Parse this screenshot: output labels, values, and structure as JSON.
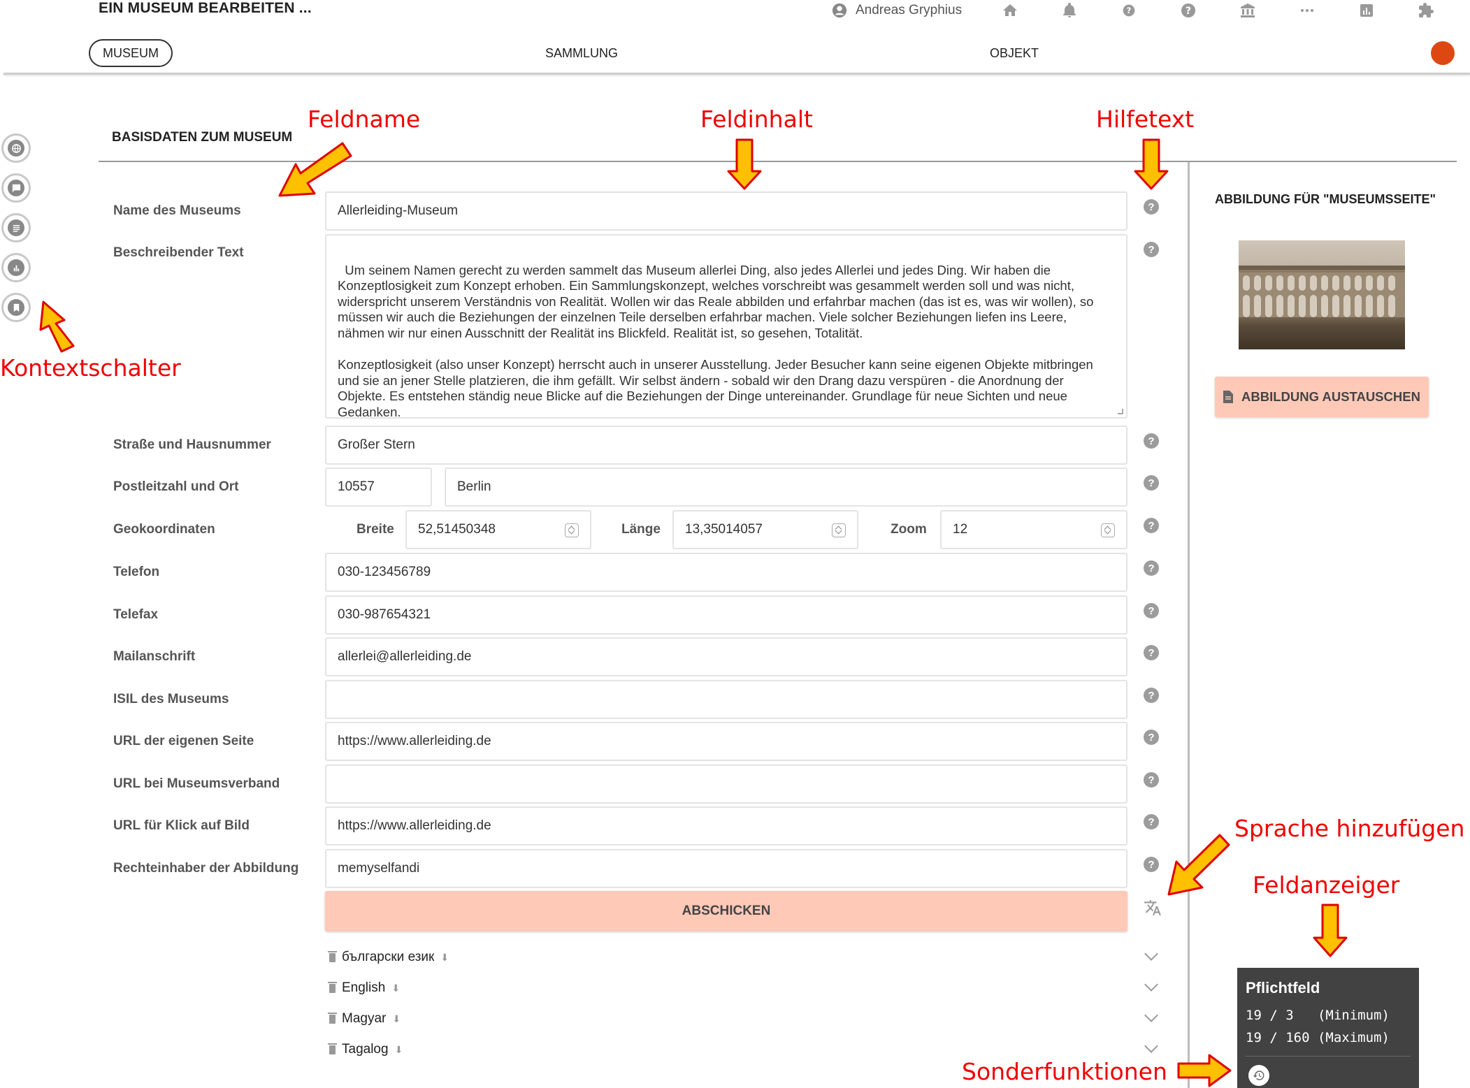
{
  "header": {
    "title": "EIN MUSEUM BEARBEITEN ...",
    "user_name": "Andreas Gryphius",
    "icons": [
      "account-icon",
      "home-icon",
      "bell-icon",
      "help-circle-icon",
      "help-icon",
      "museum-icon",
      "more-icon",
      "chart-icon",
      "puzzle-icon"
    ],
    "status_color": "#dd4812"
  },
  "nav": {
    "tabs": [
      {
        "label": "MUSEUM",
        "active": true
      },
      {
        "label": "SAMMLUNG",
        "active": false
      },
      {
        "label": "OBJEKT",
        "active": false
      }
    ]
  },
  "context_switcher": {
    "icons": [
      "globe-icon",
      "chat-icon",
      "list-icon",
      "chart-icon",
      "bookmark-icon"
    ]
  },
  "section": {
    "title": "BASISDATEN ZUM MUSEUM"
  },
  "form": {
    "name": {
      "label": "Name des Museums",
      "value": "Allerleiding-Museum"
    },
    "description": {
      "label": "Beschreibender Text",
      "value": "Um seinem Namen gerecht zu werden sammelt das Museum allerlei Ding, also jedes Allerlei und jedes Ding. Wir haben die\nKonzeptlosigkeit zum Konzept erhoben. Ein Sammlungskonzept, welches vorschreibt was gesammelt werden soll und was nicht,\nwiderspricht unserem Verständnis von Realität. Wollen wir das Reale abbilden und erfahrbar machen (das ist es, was wir wollen), so\nmüssen wir auch die Beziehungen der einzelnen Teile derselben erfahrbar machen. Viele solcher Beziehungen liefen ins Leere,\nnähmen wir nur einen Ausschnitt der Realität ins Blickfeld. Realität ist, so gesehen, Totalität.\n\nKonzeptlosigkeit (also unser Konzept) herrscht auch in unserer Ausstellung. Jeder Besucher kann seine eigenen Objekte mitbringen\nund sie an jener Stelle platzieren, die ihm gefällt. Wir selbst ändern - sobald wir den Drang dazu verspüren - die Anordnung der\nObjekte. Es entstehen ständig neue Blicke auf die Beziehungen der Dinge untereinander. Grundlage für neue Sichten und neue\nGedanken."
    },
    "street": {
      "label": "Straße und Hausnummer",
      "value": "Großer Stern"
    },
    "postal": {
      "label": "Postleitzahl und Ort",
      "zip": "10557",
      "city": "Berlin"
    },
    "geo": {
      "label": "Geokoordinaten",
      "lat_label": "Breite",
      "lat": "52,51450348",
      "lon_label": "Länge",
      "lon": "13,35014057",
      "zoom_label": "Zoom",
      "zoom": "12"
    },
    "phone": {
      "label": "Telefon",
      "value": "030-123456789"
    },
    "fax": {
      "label": "Telefax",
      "value": "030-987654321"
    },
    "mail": {
      "label": "Mailanschrift",
      "value": "allerlei@allerleiding.de"
    },
    "isil": {
      "label": "ISIL des Museums",
      "value": ""
    },
    "url_own": {
      "label": "URL der eigenen Seite",
      "value": "https://www.allerleiding.de"
    },
    "url_assoc": {
      "label": "URL bei Museumsverband",
      "value": ""
    },
    "url_click": {
      "label": "URL für Klick auf Bild",
      "value": "https://www.allerleiding.de"
    },
    "rights": {
      "label": "Rechteinhaber der Abbildung",
      "value": "memyselfandi"
    },
    "help_glyph": "?",
    "submit_label": "ABSCHICKEN"
  },
  "languages": [
    {
      "name": "български език"
    },
    {
      "name": "English"
    },
    {
      "name": "Magyar"
    },
    {
      "name": "Tagalog"
    }
  ],
  "side_panel": {
    "title": "ABBILDUNG FÜR \"MUSEUMSSEITE\"",
    "replace_label": "ABBILDUNG AUSTAUSCHEN"
  },
  "indicator": {
    "title": "Pflichtfeld",
    "min_row": "19 / 3   (Minimum)",
    "max_row": "19 / 160 (Maximum)"
  },
  "annotations": {
    "feldname": "Feldname",
    "feldinhalt": "Feldinhalt",
    "hilfetext": "Hilfetext",
    "kontextschalter": "Kontextschalter",
    "sprache": "Sprache hinzufügen",
    "feldanzeiger": "Feldanzeiger",
    "sonderfunktionen": "Sonderfunktionen",
    "text_color": "#f00000",
    "arrow_fill": "#ffc000",
    "arrow_stroke": "#e00000"
  }
}
